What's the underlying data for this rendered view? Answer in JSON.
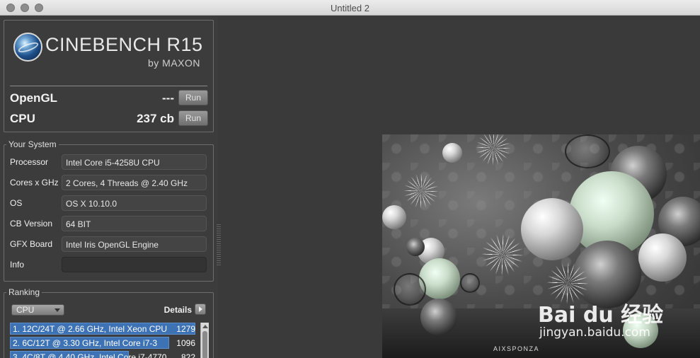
{
  "window": {
    "title": "Untitled 2"
  },
  "logo": {
    "brand": "CINEBENCH R15",
    "sub": "by MAXON"
  },
  "scores": [
    {
      "label": "OpenGL",
      "value": "---",
      "button": "Run"
    },
    {
      "label": "CPU",
      "value": "237 cb",
      "button": "Run"
    }
  ],
  "system": {
    "title": "Your System",
    "rows": [
      {
        "label": "Processor",
        "value": "Intel Core i5-4258U CPU"
      },
      {
        "label": "Cores x GHz",
        "value": "2 Cores, 4 Threads @ 2.40 GHz"
      },
      {
        "label": "OS",
        "value": "OS X 10.10.0"
      },
      {
        "label": "CB Version",
        "value": "64 BIT"
      },
      {
        "label": "GFX Board",
        "value": "Intel Iris OpenGL Engine"
      },
      {
        "label": "Info",
        "value": ""
      }
    ]
  },
  "ranking": {
    "title": "Ranking",
    "select": "CPU",
    "details": "Details",
    "items": [
      {
        "name": "1. 12C/24T @ 2.66 GHz, Intel Xeon CPU",
        "score": "1279",
        "fraction": 1.0
      },
      {
        "name": "2. 6C/12T @ 3.30 GHz,  Intel Core i7-3",
        "score": "1096",
        "fraction": 0.86
      },
      {
        "name": "3. 4C/8T @ 4.40 GHz, Intel Core i7-4770",
        "score": "822",
        "fraction": 0.64
      }
    ]
  },
  "render": {
    "studio": "AIXSPONZA",
    "watermark": "Bai du 经验",
    "watermark_url": "jingyan.baidu.com"
  },
  "colors": {
    "rank_bar": "#3d72b4",
    "panel_bg": "#3c3c3c",
    "main_bg": "#3a3a3a"
  }
}
